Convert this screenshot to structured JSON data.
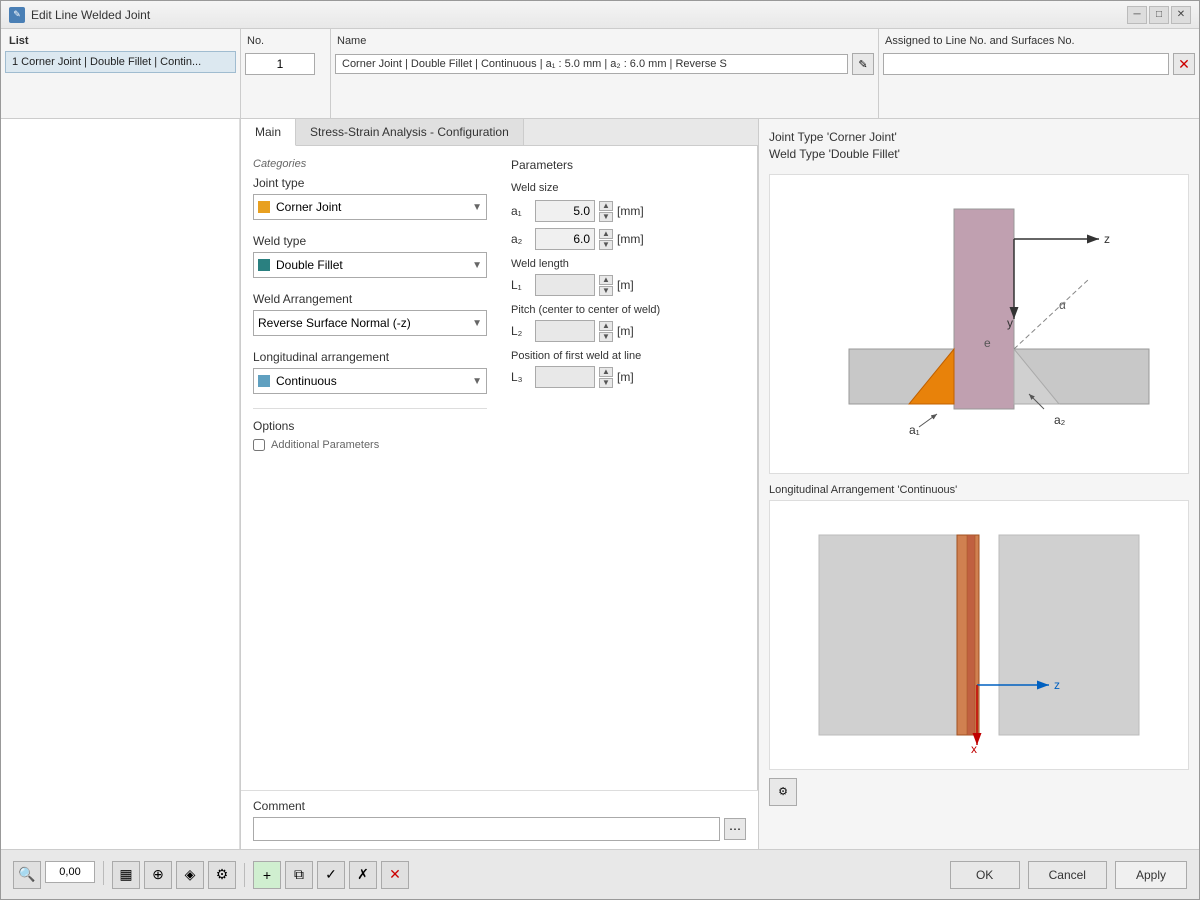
{
  "window": {
    "title": "Edit Line Welded Joint",
    "icon": "✎"
  },
  "list": {
    "header": "List",
    "items": [
      {
        "id": 1,
        "text": "1  Corner Joint | Double Fillet | Contin..."
      }
    ]
  },
  "no": {
    "label": "No.",
    "value": "1"
  },
  "name": {
    "label": "Name",
    "value": "Corner Joint | Double Fillet | Continuous | a₁ : 5.0 mm | a₂ : 6.0 mm | Reverse S"
  },
  "assigned": {
    "label": "Assigned to Line No. and Surfaces No."
  },
  "tabs": {
    "main": "Main",
    "stress": "Stress-Strain Analysis - Configuration"
  },
  "categories": {
    "label": "Categories",
    "joint_type_label": "Joint type",
    "joint_type_value": "Corner Joint",
    "joint_type_color": "#e8a020",
    "weld_type_label": "Weld type",
    "weld_type_value": "Double Fillet",
    "weld_type_color": "#2a8080",
    "weld_arrangement_label": "Weld Arrangement",
    "weld_arrangement_value": "Reverse Surface Normal (-z)",
    "longitudinal_label": "Longitudinal arrangement",
    "longitudinal_value": "Continuous",
    "longitudinal_color": "#60a0c0"
  },
  "options": {
    "label": "Options",
    "additional_params": "Additional Parameters"
  },
  "comment": {
    "label": "Comment"
  },
  "parameters": {
    "label": "Parameters",
    "weld_size_label": "Weld size",
    "a1_label": "a₁",
    "a1_value": "5.0",
    "a1_unit": "[mm]",
    "a2_label": "a₂",
    "a2_value": "6.0",
    "a2_unit": "[mm]",
    "weld_length_label": "Weld length",
    "l1_label": "L₁",
    "l1_unit": "[m]",
    "pitch_label": "Pitch (center to center of weld)",
    "l2_label": "L₂",
    "l2_unit": "[m]",
    "position_label": "Position of first weld at line",
    "l3_label": "L₃",
    "l3_unit": "[m]"
  },
  "diagrams": {
    "top_title1": "Joint Type 'Corner Joint'",
    "top_title2": "Weld Type 'Double Fillet'",
    "bottom_title": "Longitudinal Arrangement 'Continuous'"
  },
  "bottom_toolbar": {
    "zoom_value": "0,00",
    "ok_label": "OK",
    "cancel_label": "Cancel",
    "apply_label": "Apply"
  }
}
